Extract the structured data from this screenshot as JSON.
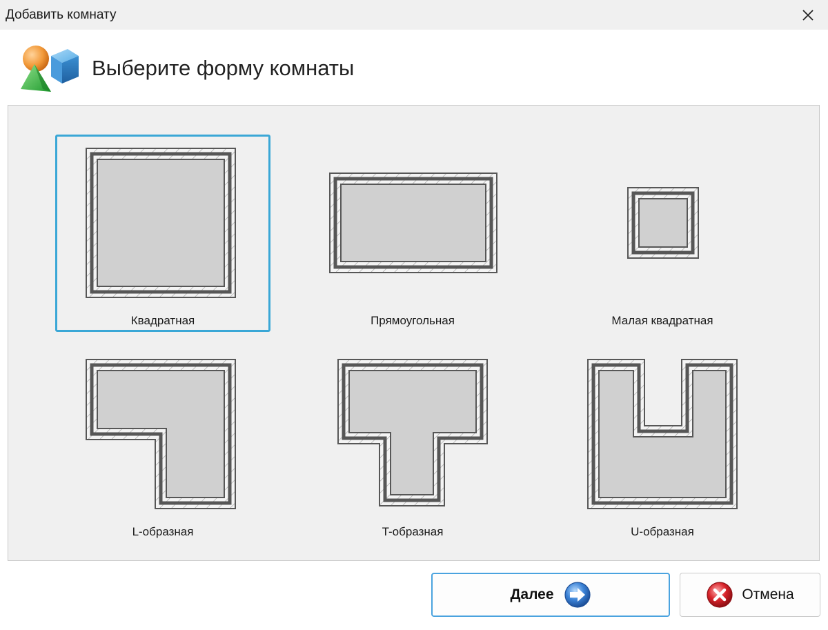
{
  "window": {
    "title": "Добавить комнату"
  },
  "header": {
    "title": "Выберите форму комнаты"
  },
  "shapes": [
    {
      "label": "Квадратная",
      "selected": true
    },
    {
      "label": "Прямоугольная",
      "selected": false
    },
    {
      "label": "Малая квадратная",
      "selected": false
    },
    {
      "label": "L-образная",
      "selected": false
    },
    {
      "label": "T-образная",
      "selected": false
    },
    {
      "label": "U-образная",
      "selected": false
    }
  ],
  "buttons": {
    "next_label": "Далее",
    "cancel_label": "Отмена"
  },
  "colors": {
    "selection": "#3aa7d6",
    "floor": "#d0d0d0",
    "wall": "#575757",
    "next_icon": "#3b82d6",
    "cancel_icon": "#d8232a"
  },
  "icons": {
    "close": "close-icon",
    "logo": "shapes-logo-icon",
    "next": "arrow-right-circle-icon",
    "cancel": "x-circle-icon"
  }
}
